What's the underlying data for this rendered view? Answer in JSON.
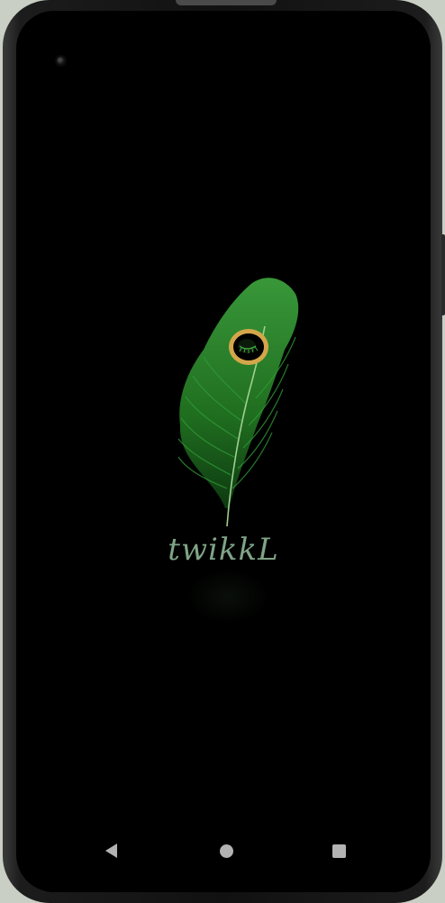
{
  "app": {
    "brand_name": "twikkL"
  },
  "logo": {
    "icon": "peacock-feather-icon",
    "feather_color": "#2e8a2e",
    "eye_color": "#d4a64a"
  },
  "navigation": {
    "back_icon": "back-triangle-icon",
    "home_icon": "home-circle-icon",
    "recents_icon": "recents-square-icon"
  },
  "colors": {
    "background": "#000000",
    "brand_text": "#7fa487",
    "nav_icons": "#b3b3b3"
  }
}
